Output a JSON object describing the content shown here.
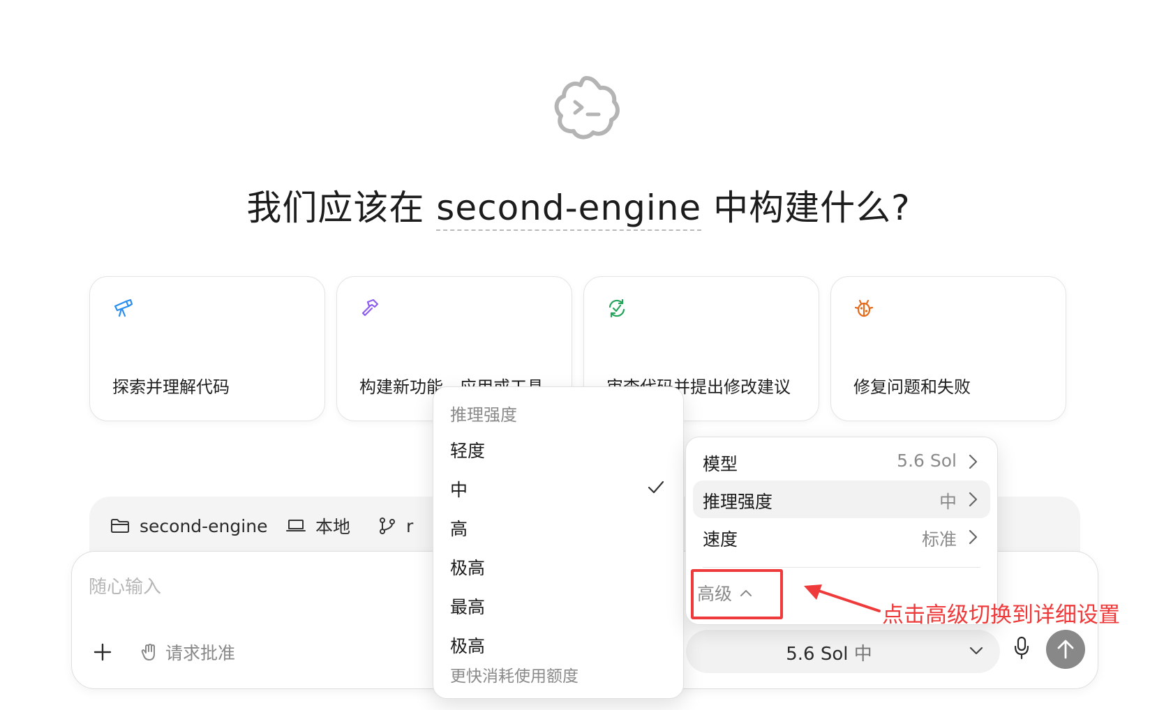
{
  "headline": {
    "prefix": "我们应该在",
    "project": "second-engine",
    "suffix": "中构建什么?"
  },
  "cards": [
    {
      "icon": "telescope-icon",
      "label": "探索并理解代码",
      "color": "#2a8ef0"
    },
    {
      "icon": "hammer-icon",
      "label": "构建新功能、应用或工具",
      "color": "#8d5df0"
    },
    {
      "icon": "review-cycle-icon",
      "label": "审查代码并提出修改建议",
      "color": "#23a45a"
    },
    {
      "icon": "bug-icon",
      "label": "修复问题和失败",
      "color": "#e46a1a"
    }
  ],
  "context_bar": {
    "folder": "second-engine",
    "environment": "本地",
    "branch": "r"
  },
  "composer": {
    "placeholder": "随心输入",
    "approval": "请求批准",
    "model": "5.6 Sol",
    "effort": "中"
  },
  "effort_menu": {
    "heading": "推理强度",
    "options": [
      "轻度",
      "中",
      "高",
      "极高",
      "最高",
      "极高"
    ],
    "selected": "中",
    "last_option_note": "更快消耗使用额度"
  },
  "settings_menu": {
    "rows": [
      {
        "label": "模型",
        "value": "5.6 Sol"
      },
      {
        "label": "推理强度",
        "value": "中"
      },
      {
        "label": "速度",
        "value": "标准"
      }
    ],
    "active_row": "推理强度",
    "advanced": "高级"
  },
  "annotation": {
    "text": "点击高级切换到详细设置",
    "color": "#ee3a3a"
  }
}
